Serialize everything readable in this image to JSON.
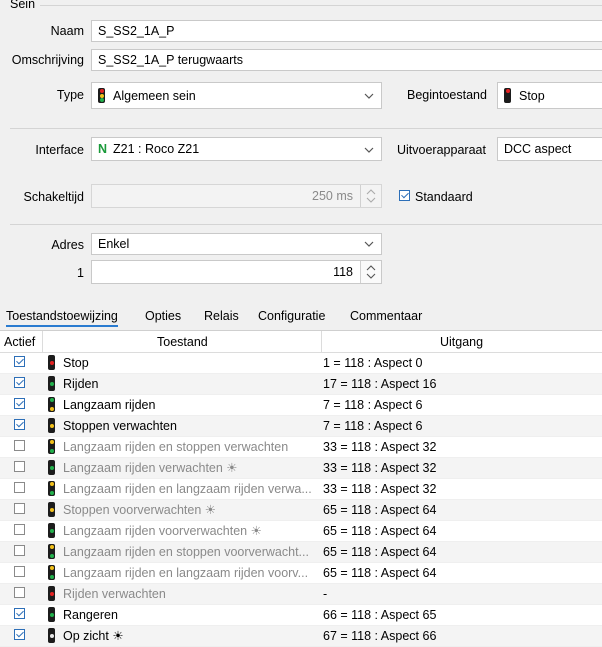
{
  "group_title": "Sein",
  "fields": {
    "naam": {
      "label": "Naam",
      "value": "S_SS2_1A_P"
    },
    "omschrijving": {
      "label": "Omschrijving",
      "value": "S_SS2_1A_P terugwaarts"
    },
    "type": {
      "label": "Type",
      "value": "Algemeen sein"
    },
    "begintoestand": {
      "label": "Begintoestand",
      "value": "Stop"
    },
    "interface": {
      "label": "Interface",
      "prefix": "N",
      "value": "Z21 : Roco Z21"
    },
    "uitvoerapparaat": {
      "label": "Uitvoerapparaat",
      "value": "DCC aspect"
    },
    "schakeltijd": {
      "label": "Schakeltijd",
      "value": "250 ms"
    },
    "standaard": {
      "label": "Standaard",
      "checked": true
    },
    "adres": {
      "label": "Adres",
      "value": "Enkel"
    },
    "adres1": {
      "label": "1",
      "value": "118"
    }
  },
  "tabs": [
    "Toestandstoewijzing",
    "Opties",
    "Relais",
    "Configuratie",
    "Commentaar"
  ],
  "table": {
    "headers": {
      "actief": "Actief",
      "toestand": "Toestand",
      "uitgang": "Uitgang"
    },
    "rows": [
      {
        "checked": true,
        "toestand": "Stop",
        "uitgang": "1 = 118 : Aspect 0",
        "lamps": [
          "red"
        ]
      },
      {
        "checked": true,
        "toestand": "Rijden",
        "uitgang": "17 = 118 : Aspect 16",
        "lamps": [
          "green"
        ]
      },
      {
        "checked": true,
        "toestand": "Langzaam rijden",
        "uitgang": "7 = 118 : Aspect 6",
        "lamps": [
          "green",
          "yellow"
        ]
      },
      {
        "checked": true,
        "toestand": "Stoppen verwachten",
        "uitgang": "7 = 118 : Aspect 6",
        "lamps": [
          "yellow"
        ]
      },
      {
        "checked": false,
        "toestand": "Langzaam rijden en stoppen verwachten",
        "uitgang": "33 = 118 : Aspect 32",
        "lamps": [
          "yellow",
          "green"
        ]
      },
      {
        "checked": false,
        "toestand": "Langzaam rijden verwachten ☀",
        "uitgang": "33 = 118 : Aspect 32",
        "lamps": [
          "green"
        ]
      },
      {
        "checked": false,
        "toestand": "Langzaam rijden en langzaam rijden verwa...",
        "uitgang": "33 = 118 : Aspect 32",
        "lamps": [
          "yellow",
          "green"
        ]
      },
      {
        "checked": false,
        "toestand": "Stoppen voorverwachten ☀",
        "uitgang": "65 = 118 : Aspect 64",
        "lamps": [
          "yellow"
        ]
      },
      {
        "checked": false,
        "toestand": "Langzaam rijden voorverwachten ☀",
        "uitgang": "65 = 118 : Aspect 64",
        "lamps": [
          "green"
        ]
      },
      {
        "checked": false,
        "toestand": "Langzaam rijden en stoppen voorverwacht...",
        "uitgang": "65 = 118 : Aspect 64",
        "lamps": [
          "yellow",
          "green"
        ]
      },
      {
        "checked": false,
        "toestand": "Langzaam rijden en langzaam rijden voorv...",
        "uitgang": "65 = 118 : Aspect 64",
        "lamps": [
          "yellow",
          "green"
        ]
      },
      {
        "checked": false,
        "toestand": "Rijden verwachten",
        "uitgang": "-",
        "lamps": [
          "red"
        ]
      },
      {
        "checked": true,
        "toestand": "Rangeren",
        "uitgang": "66 = 118 : Aspect 65",
        "lamps": [
          "green"
        ]
      },
      {
        "checked": true,
        "toestand": "Op zicht ☀",
        "uitgang": "67 = 118 : Aspect 66",
        "lamps": [
          "white"
        ]
      }
    ]
  },
  "colors": {
    "red": "#e52222",
    "green": "#22b14c",
    "yellow": "#f2c01a",
    "white": "#e8e8e8",
    "interface_prefix": "#1a9a3a",
    "accent": "#2a7bd0"
  }
}
